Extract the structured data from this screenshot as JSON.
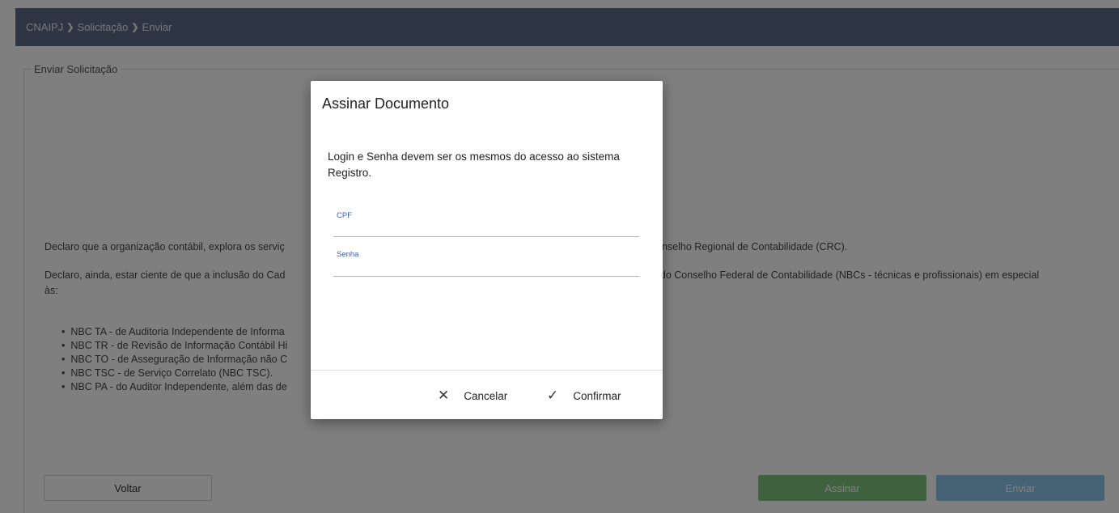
{
  "breadcrumb": {
    "items": [
      "CNAIPJ",
      "Solicitação",
      "Enviar"
    ],
    "separator": ">"
  },
  "section": {
    "legend": "Enviar Solicitação",
    "declaration_1": "Declaro que a organização contábil, explora os serviç                                                                                          Conselho Regional de Contabilidade (CRC).",
    "declaration_1_left": "Declaro que a organização contábil, explora os serviç",
    "declaration_1_right": "Conselho Regional de Contabilidade (CRC).",
    "declaration_2_left": "Declaro, ainda, estar ciente de que a inclusão do Cad",
    "declaration_2_right": "J) do Conselho Federal de Contabilidade (NBCs - técnicas e profissionais) em especial",
    "declaration_2_cont": "às:",
    "norms": [
      "NBC TA - de Auditoria Independente de Informa",
      "NBC TR - de Revisão de Informação Contábil Hi",
      "NBC TO - de Asseguração de Informação não C",
      "NBC TSC - de Serviço Correlato (NBC TSC).",
      "NBC PA - do Auditor Independente, além das de"
    ]
  },
  "buttons": {
    "back": "Voltar",
    "sign": "Assinar",
    "send": "Enviar"
  },
  "modal": {
    "title": "Assinar Documento",
    "message": "Login e Senha devem ser os mesmos do acesso ao sistema Registro.",
    "cpf_label": "CPF",
    "cpf_value": "",
    "password_label": "Senha",
    "password_value": "",
    "cancel_label": "Cancelar",
    "cancel_icon": "close-icon",
    "confirm_label": "Confirmar",
    "confirm_icon": "check-icon"
  },
  "colors": {
    "topbar": "#5c6b87",
    "sign_button": "#7ec27d",
    "send_button": "#8cc5eb",
    "field_label": "#3a5bc7"
  }
}
